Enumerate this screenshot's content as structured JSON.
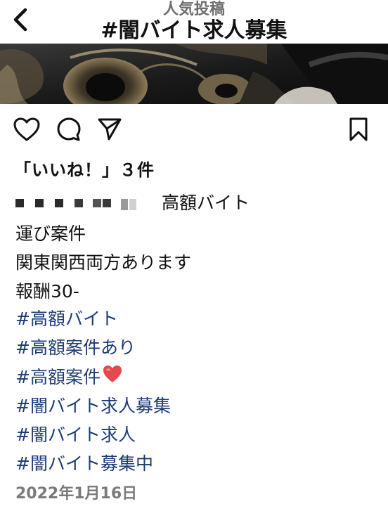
{
  "header": {
    "subtitle": "人気投稿",
    "title": "#闇バイト求人募集",
    "back_icon": "chevron-left-icon"
  },
  "actions": {
    "like_icon": "heart-outline-icon",
    "comment_icon": "comment-icon",
    "share_icon": "send-icon",
    "save_icon": "bookmark-icon"
  },
  "post": {
    "likes": "「いいね！」３件",
    "username": "",
    "caption_first_line": "高額バイト",
    "caption_lines": [
      "運び案件",
      "関東関西両方あります",
      "報酬30-"
    ],
    "hashtags": [
      "#高額バイト",
      "#高額案件あり",
      "#高額案件",
      "#闇バイト求人募集",
      "#闇バイト求人",
      "#闇バイト募集中"
    ],
    "hashtag_color": "#1d3b75",
    "emoji_icon": "red-heart-icon",
    "date": "2022年1月16日"
  }
}
